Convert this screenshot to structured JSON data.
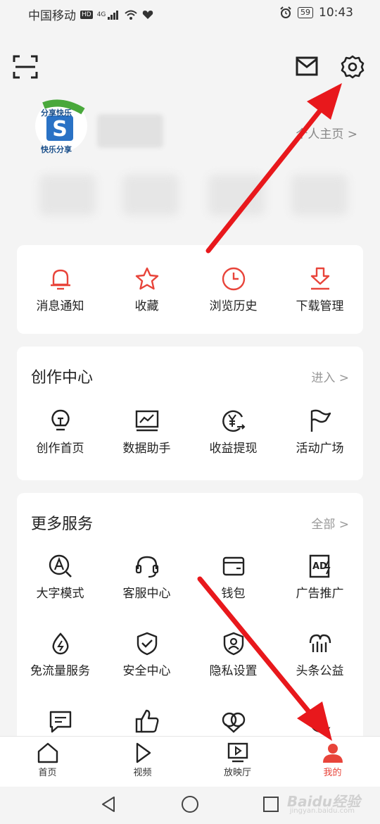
{
  "status_bar": {
    "carrier": "中国移动",
    "hd": "HD",
    "network": "4G",
    "battery": "59",
    "time": "10:43"
  },
  "header": {
    "scan_icon": "scan-icon",
    "mail_icon": "mail-icon",
    "settings_icon": "gear-icon"
  },
  "profile": {
    "avatar_caption_top": "分享快乐",
    "avatar_caption_bottom": "快乐分享",
    "home_link": "个人主页 >"
  },
  "quick_actions": [
    {
      "label": "消息通知",
      "icon": "bell-icon"
    },
    {
      "label": "收藏",
      "icon": "star-icon"
    },
    {
      "label": "浏览历史",
      "icon": "clock-icon"
    },
    {
      "label": "下载管理",
      "icon": "download-icon"
    }
  ],
  "creator_center": {
    "title": "创作中心",
    "more": "进入 >",
    "items": [
      {
        "label": "创作首页",
        "icon": "lightbulb-icon"
      },
      {
        "label": "数据助手",
        "icon": "chart-monitor-icon"
      },
      {
        "label": "收益提现",
        "icon": "yen-exchange-icon"
      },
      {
        "label": "活动广场",
        "icon": "flag-icon"
      }
    ]
  },
  "more_services": {
    "title": "更多服务",
    "more": "全部 >",
    "items": [
      {
        "label": "大字模式",
        "icon": "text-zoom-icon"
      },
      {
        "label": "客服中心",
        "icon": "headset-icon"
      },
      {
        "label": "钱包",
        "icon": "wallet-icon"
      },
      {
        "label": "广告推广",
        "icon": "ad-icon"
      },
      {
        "label": "免流量服务",
        "icon": "data-drop-icon"
      },
      {
        "label": "安全中心",
        "icon": "shield-check-icon"
      },
      {
        "label": "隐私设置",
        "icon": "privacy-shield-icon"
      },
      {
        "label": "头条公益",
        "icon": "charity-icon"
      }
    ],
    "partial_row_icons": [
      "feedback-icon",
      "thumbs-up-icon",
      "heart-link-icon",
      "moon-icon"
    ]
  },
  "tab_bar": [
    {
      "label": "首页",
      "icon": "home-icon",
      "active": false
    },
    {
      "label": "视频",
      "icon": "play-icon",
      "active": false
    },
    {
      "label": "放映厅",
      "icon": "screen-play-icon",
      "active": false
    },
    {
      "label": "我的",
      "icon": "person-icon",
      "active": true
    }
  ],
  "watermark": {
    "text": "Baidu经验",
    "sub": "jingyan.baidu.com"
  },
  "colors": {
    "accent": "#e8443a",
    "arrow": "#e8181c",
    "icon": "#222222"
  }
}
